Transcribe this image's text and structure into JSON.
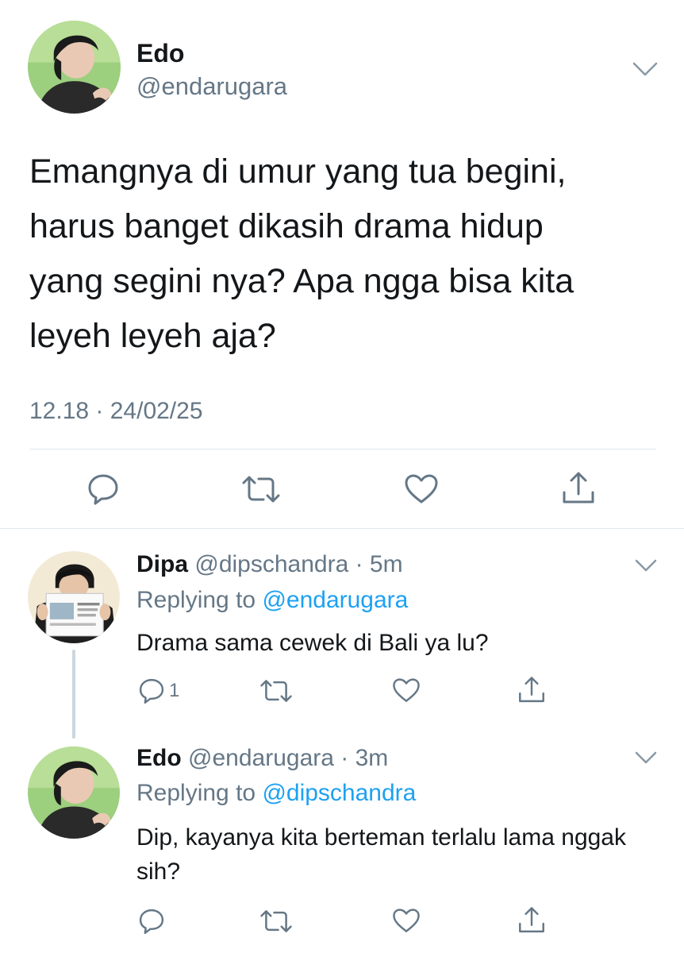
{
  "main_tweet": {
    "name": "Edo",
    "handle": "@endarugara",
    "text_lines": [
      "Emangnya di umur yang tua begini,",
      "harus banget dikasih drama hidup",
      "yang segini nya? Apa ngga bisa kita",
      "leyeh leyeh aja?"
    ],
    "timestamp": "12.18 · 24/02/25",
    "menu_icon": "chevron-down-icon",
    "actions": [
      "reply-icon",
      "retweet-icon",
      "like-icon",
      "share-icon"
    ]
  },
  "replies": [
    {
      "name": "Dipa",
      "handle": "@dipschandra",
      "time": "· 5m",
      "replying_prefix": "Replying to",
      "replying_to": "@endarugara",
      "text": "Drama sama cewek di Bali ya lu?",
      "reply_count": "1"
    },
    {
      "name": "Edo",
      "handle": "@endarugara",
      "time": "· 3m",
      "replying_prefix": "Replying to",
      "replying_to": "@dipschandra",
      "text": "Dip, kayanya kita berteman terlalu lama nggak sih?",
      "reply_count": ""
    }
  ],
  "colors": {
    "text": "#14171a",
    "secondary": "#657786",
    "accent": "#1da1f2",
    "divider": "#e1e8ed",
    "thread_line": "#ccd6dd"
  }
}
